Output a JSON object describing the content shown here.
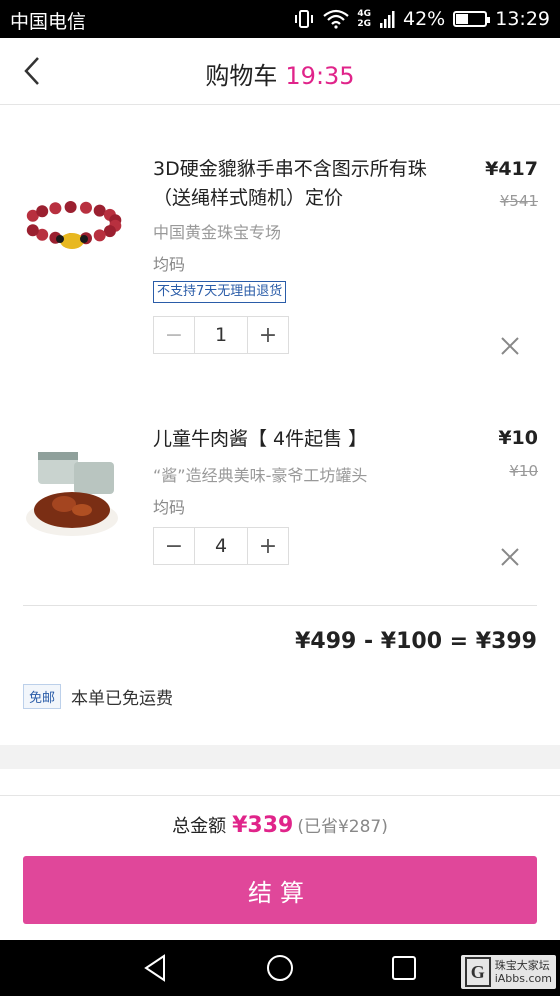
{
  "status_bar": {
    "carrier": "中国电信",
    "network_top": "4G",
    "network_bottom": "2G",
    "battery": "42%",
    "battery_level": 0.42,
    "time": "13:29"
  },
  "header": {
    "title": "购物车",
    "countdown": "19:35"
  },
  "items": [
    {
      "title": "3D硬金貔貅手串不含图示所有珠（送绳样式随机）定价",
      "shop": "中国黄金珠宝专场",
      "size": "均码",
      "tag": "不支持7天无理由退货",
      "price": "¥417",
      "old_price": "¥541",
      "quantity": "1",
      "minus": "−",
      "plus": "+"
    },
    {
      "title": "儿童牛肉酱【 4件起售 】",
      "shop": "“酱”造经典美味-豪爷工坊罐头",
      "size": "均码",
      "price": "¥10",
      "old_price": "¥10",
      "quantity": "4",
      "minus": "−",
      "plus": "+"
    }
  ],
  "summary": {
    "formula": "¥499 - ¥100 = ¥399",
    "shipping_tag": "免邮",
    "shipping_text": "本单已免运费"
  },
  "footer": {
    "total_label": "总金额",
    "total_amount": "¥339",
    "saved": "(已省¥287)",
    "checkout_label": "结算"
  },
  "watermark": {
    "logo": "G",
    "line1": "珠宝大家坛",
    "line2": "iAbbs.com"
  },
  "colors": {
    "accent": "#e0248a",
    "checkout_bg": "#e0479a",
    "tag_blue": "#2a5ca8"
  }
}
